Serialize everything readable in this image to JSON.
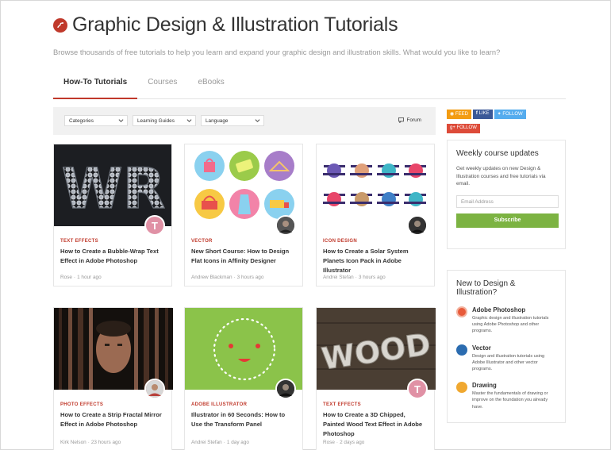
{
  "header": {
    "title": "Graphic Design & Illustration Tutorials",
    "subtitle": "Browse thousands of free tutorials to help you learn and expand your graphic design and illustration skills. What would you like to learn?"
  },
  "tabs": [
    {
      "label": "How-To Tutorials",
      "active": true
    },
    {
      "label": "Courses",
      "active": false
    },
    {
      "label": "eBooks",
      "active": false
    }
  ],
  "filters": {
    "categories": "Categories",
    "learning_guides": "Learning Guides",
    "language": "Language",
    "forum": "Forum"
  },
  "cards": [
    {
      "category": "Text Effects",
      "title": "How to Create a Bubble-Wrap Text Effect in Adobe Photoshop",
      "author": "Rose",
      "time": "1 hour ago",
      "avatar": "T"
    },
    {
      "category": "Vector",
      "title": "New Short Course: How to Design Flat Icons in Affinity Designer",
      "author": "Andrew Blackman",
      "time": "3 hours ago"
    },
    {
      "category": "Icon Design",
      "title": "How to Create a Solar System Planets Icon Pack in Adobe Illustrator",
      "author": "Andrei Stefan",
      "time": "3 hours ago"
    },
    {
      "category": "Photo Effects",
      "title": "How to Create a Strip Fractal Mirror Effect in Adobe Photoshop",
      "author": "Kirk Nelson",
      "time": "23 hours ago"
    },
    {
      "category": "Adobe Illustrator",
      "title": "Illustrator in 60 Seconds: How to Use the Transform Panel",
      "author": "Andrei Stefan",
      "time": "1 day ago"
    },
    {
      "category": "Text Effects",
      "title": "How to Create a 3D Chipped, Painted Wood Text Effect in Adobe Photoshop",
      "author": "Rose",
      "time": "2 days ago",
      "avatar": "T"
    }
  ],
  "thumb_text": {
    "wr": "WR",
    "wood": "WOOD"
  },
  "social": {
    "feed": "FEED",
    "like": "LIKE",
    "follow": "FOLLOW",
    "gplus_follow": "FOLLOW"
  },
  "weekly": {
    "heading": "Weekly course updates",
    "text": "Get weekly updates on new Design & Illustration courses and free tutorials via email.",
    "email_placeholder": "Email Address",
    "subscribe_label": "Subscribe"
  },
  "new_to": {
    "heading": "New to Design & Illustration?",
    "items": [
      {
        "title": "Adobe Photoshop",
        "desc": "Graphic design and illustration tutorials using Adobe Photoshop and other programs.",
        "icon": "photoshop-icon"
      },
      {
        "title": "Vector",
        "desc": "Design and illustration tutorials using Adobe Illustrator and other vector programs.",
        "icon": "pen-icon"
      },
      {
        "title": "Drawing",
        "desc": "Master the fundamentals of drawing or improve on the foundation you already have.",
        "icon": "pencil-icon"
      }
    ]
  },
  "colors": {
    "accent": "#c0392b",
    "subscribe": "#7cb342",
    "feed": "#f39c12",
    "like": "#3b5998",
    "twitter": "#55acee",
    "gplus": "#dd4b39"
  }
}
